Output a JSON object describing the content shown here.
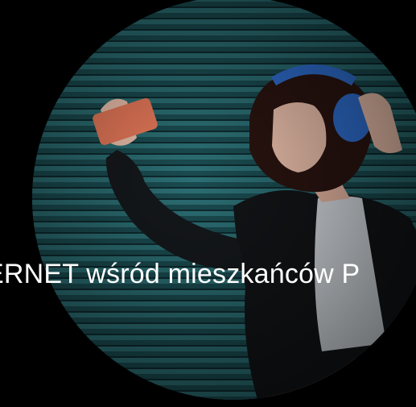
{
  "hero": {
    "image_icon": "woman-with-headphones-photo",
    "colors": {
      "background": "#000000",
      "shutter_dark": "#0f3339",
      "shutter_light": "#2b6e73",
      "phone": "#e8795a",
      "headphones": "#2f6fd1",
      "jacket": "#121417",
      "shirt": "#d8dde2",
      "skirt": "#f2664c"
    }
  },
  "headline": {
    "part1": "ERNET",
    "part2": " wśród mieszkańców P"
  }
}
